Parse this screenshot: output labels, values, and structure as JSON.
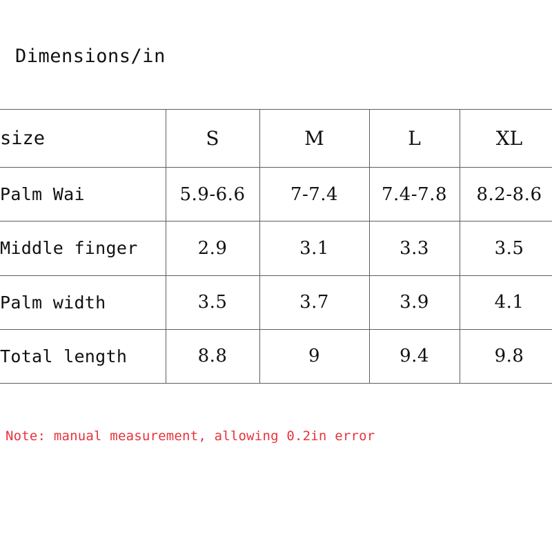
{
  "title": "Dimensions/in",
  "note": {
    "text": "Note: manual measurement, allowing 0.2in error",
    "color": "#e8323c"
  },
  "colors": {
    "border": "#5d5d5d",
    "text": "#111111",
    "background": "#ffffff",
    "note_red": "#e8323c"
  },
  "chart_data": {
    "type": "table",
    "title": "Dimensions/in",
    "columns": [
      "size",
      "S",
      "M",
      "L",
      "XL"
    ],
    "rows": [
      {
        "label": "Palm Wai",
        "values": [
          "5.9-6.6",
          "7-7.4",
          "7.4-7.8",
          "8.2-8.6"
        ]
      },
      {
        "label": "Middle finger",
        "values": [
          "2.9",
          "3.1",
          "3.3",
          "3.5"
        ]
      },
      {
        "label": "Palm width",
        "values": [
          "3.5",
          "3.7",
          "3.9",
          "4.1"
        ]
      },
      {
        "label": "Total length",
        "values": [
          "8.8",
          "9",
          "9.4",
          "9.8"
        ]
      }
    ],
    "unit": "in",
    "note": "Note: manual measurement, allowing 0.2in error"
  }
}
